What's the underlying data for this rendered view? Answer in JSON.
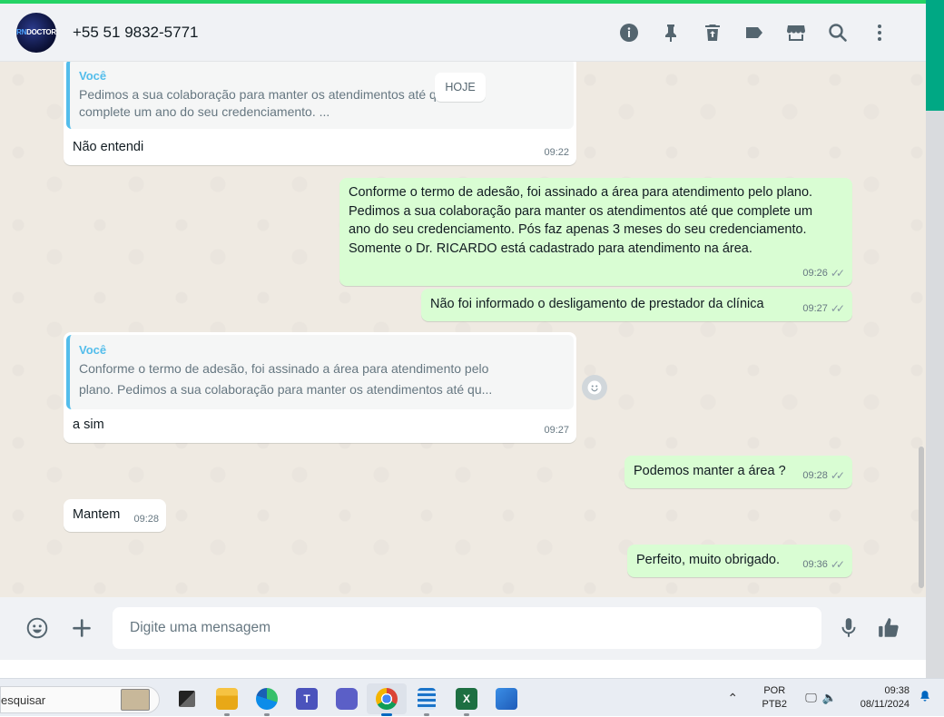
{
  "header": {
    "avatar_text_a": "RN",
    "avatar_text_b": "DOCTOR",
    "contact_name": "+55 51 9832-5771"
  },
  "chat": {
    "date_chip": "HOJE",
    "messages": [
      {
        "direction": "in",
        "quote_author": "Você",
        "quote_line1": "Pedimos a sua colaboração para manter os atendimentos até que",
        "quote_line2": "complete um ano do seu credenciamento. ...",
        "text": "Não entendi",
        "time": "09:22"
      },
      {
        "direction": "out",
        "text": "Conforme o termo de adesão, foi assinado a área para atendimento pelo plano. Pedimos a sua colaboração para manter os atendimentos até que complete um ano do seu credenciamento. Pós faz apenas 3 meses do seu credenciamento. Somente o Dr. RICARDO está cadastrado para atendimento na área.",
        "time": "09:26"
      },
      {
        "direction": "out",
        "text": "Não foi informado o desligamento de prestador da clínica",
        "time": "09:27"
      },
      {
        "direction": "in",
        "quote_author": "Você",
        "quote_line1": "Conforme o termo de adesão, foi assinado a área para atendimento pelo",
        "quote_line2": "plano. Pedimos a sua colaboração para manter os atendimentos até qu...",
        "text": "a sim",
        "time": "09:27"
      },
      {
        "direction": "out",
        "text": "Podemos manter a área ?",
        "time": "09:28"
      },
      {
        "direction": "in",
        "text": "Mantem",
        "time": "09:28"
      },
      {
        "direction": "out",
        "text": "Perfeito, muito obrigado.",
        "time": "09:36"
      }
    ]
  },
  "composer": {
    "placeholder": "Digite uma mensagem"
  },
  "taskbar": {
    "search_text": "esquisar",
    "lang_line1": "POR",
    "lang_line2": "PTB2",
    "time": "09:38",
    "date": "08/11/2024"
  },
  "icons": {
    "header": [
      "info-icon",
      "pin-icon",
      "trash-icon",
      "label-icon",
      "store-icon",
      "search-icon",
      "more-icon"
    ],
    "composer": [
      "emoji-icon",
      "plus-icon",
      "mic-icon",
      "thumbs-up-icon"
    ]
  },
  "colors": {
    "outgoing_bubble": "#d9fdd3",
    "incoming_bubble": "#ffffff",
    "quote_accent": "#53bdeb",
    "chat_background": "#efeae2",
    "brand_green": "#00a884"
  }
}
